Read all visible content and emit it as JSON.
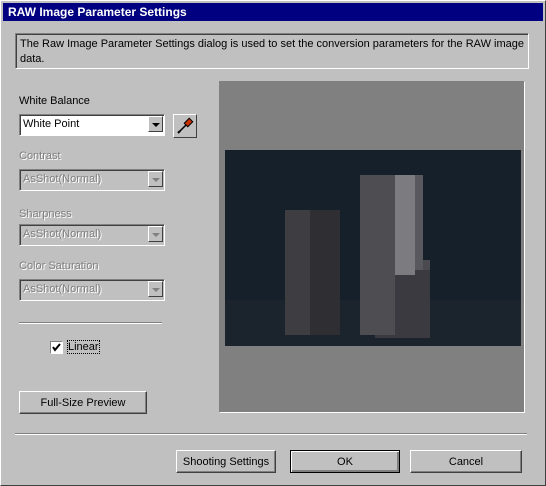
{
  "window": {
    "title": "RAW Image Parameter Settings"
  },
  "description": "The Raw Image Parameter Settings dialog is used to set the conversion parameters for the RAW image data.",
  "white_balance": {
    "label": "White Balance",
    "value": "White Point",
    "picker_icon": "eyedropper-icon"
  },
  "contrast": {
    "label": "Contrast",
    "value": "AsShot(Normal)",
    "enabled": false
  },
  "sharpness": {
    "label": "Sharpness",
    "value": "AsShot(Normal)",
    "enabled": false
  },
  "color_saturation": {
    "label": "Color Saturation",
    "value": "AsShot(Normal)",
    "enabled": false
  },
  "linear": {
    "label": "Linear",
    "checked": true
  },
  "buttons": {
    "full_size_preview": "Full-Size Preview",
    "shooting_settings": "Shooting Settings",
    "ok": "OK",
    "cancel": "Cancel"
  },
  "colors": {
    "title_bar": "#000080",
    "face": "#c0c0c0",
    "preview_bg": "#808080"
  }
}
